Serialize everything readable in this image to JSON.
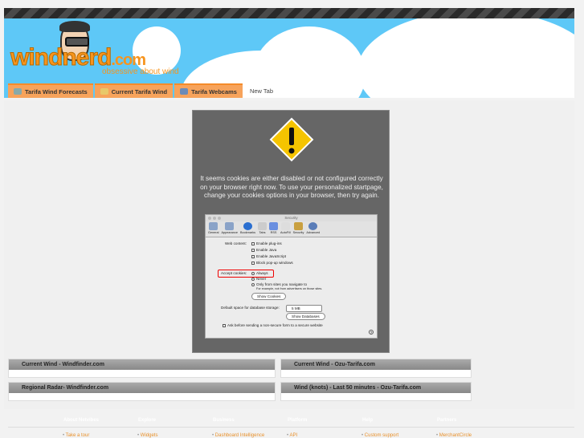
{
  "logo": {
    "text": "windnerd",
    "tld": ".com",
    "tagline": "obsessive about wind"
  },
  "tabs": [
    "Tarifa Wind Forecasts",
    "Current Tarifa Wind",
    "Tarifa Webcams",
    "New Tab"
  ],
  "dialog": {
    "message": "It seems cookies are either disabled or not configured correctly on your browser right now. To use your personalized startpage, change your cookies options in your browser, then try again.",
    "prefs": {
      "title": "Security",
      "toolbar": [
        "General",
        "Appearance",
        "Bookmarks",
        "Tabs",
        "RSS",
        "AutoFill",
        "Security",
        "Advanced"
      ],
      "web_content_label": "Web content:",
      "web_content": [
        "Enable plug-ins",
        "Enable Java",
        "Enable JavaScript",
        "Block pop-up windows"
      ],
      "accept_label": "Accept cookies:",
      "accept_options": [
        "Always",
        "Never",
        "Only from sites you navigate to"
      ],
      "accept_note": "For example, not from advertisers on those sites.",
      "show_cookies": "Show Cookies",
      "db_label": "Default space for database storage:",
      "db_value": "5 MB",
      "show_databases": "Show Databases",
      "ask_label": "Ask before sending a non-secure form to a secure website",
      "help": "?"
    }
  },
  "widgets": [
    "Current Wind - Windfinder.com",
    "Current Wind - Ozu-Tarifa.com",
    "Regional Radar- Windfinder.com",
    "Wind (knots) - Last 50 minutes - Ozu-Tarifa.com"
  ],
  "footer": {
    "headers": [
      "About Netvibes",
      "Explore",
      "Business",
      "Platform",
      "Help",
      "Partners"
    ],
    "links": [
      "Take a tour",
      "Widgets",
      "Dashboard Intelligence",
      "API",
      "Custom support",
      "MerchantCircle"
    ]
  }
}
